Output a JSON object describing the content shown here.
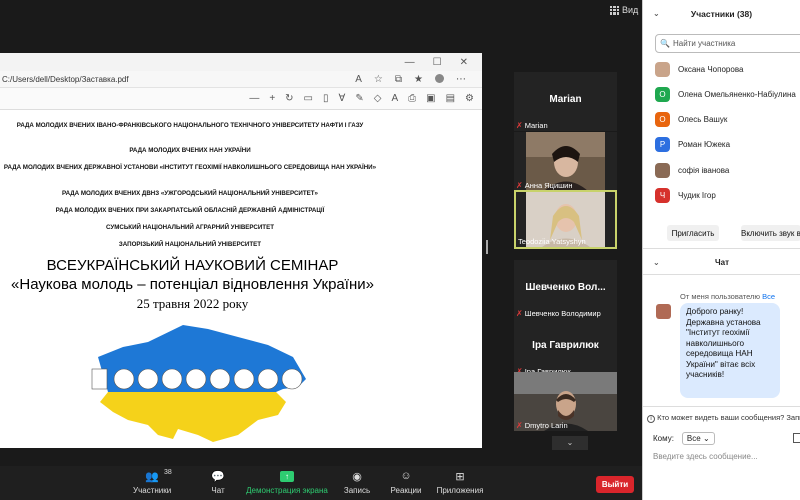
{
  "top": {
    "view_label": "Вид"
  },
  "pdf": {
    "url": "C:/Users/dell/Desktop/Заставка.pdf",
    "orgs": [
      "РАДА МОЛОДИХ ВЧЕНИХ ІВАНО-ФРАНКІВСЬКОГО НАЦІОНАЛЬНОГО ТЕХНІЧНОГО УНІВЕРСИТЕТУ НАФТИ І ГАЗУ",
      "РАДА МОЛОДИХ ВЧЕНИХ НАН УКРАЇНИ",
      "РАДА МОЛОДИХ ВЧЕНИХ ДЕРЖАВНОЇ УСТАНОВИ «ІНСТИТУТ ГЕОХІМІЇ НАВКОЛИШНЬОГО СЕРЕДОВИЩА НАН УКРАЇНИ»",
      "РАДА МОЛОДИХ ВЧЕНИХ ДВНЗ «УЖГОРОДСЬКИЙ НАЦІОНАЛЬНИЙ УНІВЕРСИТЕТ»",
      "РАДА МОЛОДИХ ВЧЕНИХ ПРИ ЗАКАРПАТСЬКІЙ ОБЛАСНІЙ ДЕРЖАВНІЙ АДМІНІСТРАЦІЇ",
      "СУМСЬКИЙ НАЦІОНАЛЬНИЙ АГРАРНИЙ УНІВЕРСИТЕТ",
      "ЗАПОРІЗЬКИЙ НАЦІОНАЛЬНИЙ УНІВЕРСИТЕТ"
    ],
    "title_line1": "ВСЕУКРАЇНСЬКИЙ НАУКОВИЙ СЕМІНАР",
    "title_line2": "«Наукова молодь – потенціал відновлення України»",
    "date": "25 травня 2022 року"
  },
  "tiles": [
    {
      "big_name": "Marian",
      "caption": "Marian"
    },
    {
      "caption": "Анна Яцишин"
    },
    {
      "caption": "Teodoziia Yatsyshyn"
    },
    {
      "big_name": "Шевченко Вол...",
      "caption": "Шевченко Володимир"
    },
    {
      "big_name": "Іра Гаврилюк",
      "caption": "Іра Гаврилюк"
    },
    {
      "caption": "Dmytro Larin"
    }
  ],
  "toolbar": {
    "participants_label": "Участники",
    "participants_count": "38",
    "chat_label": "Чат",
    "share_label": "Демонстрация экрана",
    "record_label": "Запись",
    "reactions_label": "Реакции",
    "apps_label": "Приложения",
    "leave_label": "Выйти"
  },
  "participants_panel": {
    "title": "Участники (38)",
    "search_placeholder": "Найти участника",
    "list": [
      {
        "name": "Оксана Чопорова",
        "initial": "",
        "color": "#c9a48a"
      },
      {
        "name": "Олена Омельяненко-Набіулина",
        "initial": "О",
        "color": "#1fa84f"
      },
      {
        "name": "Олесь Вашук",
        "initial": "О",
        "color": "#e8650e"
      },
      {
        "name": "Роман Южека",
        "initial": "Р",
        "color": "#2d6fe0"
      },
      {
        "name": "софія іванова",
        "initial": "",
        "color": "#8a6a55"
      },
      {
        "name": "Чудик Ігор",
        "initial": "Ч",
        "color": "#d6312c"
      }
    ],
    "invite_label": "Пригласить",
    "mute_all_label": "Включить звук всем"
  },
  "chat_panel": {
    "title": "Чат",
    "from_prefix": "От меня пользователю",
    "from_target": "Все",
    "message": "Доброго ранку! Державна установа \"Інститут геохімії навколишнього середовища НАН України\" вітає всіх учасників!",
    "who_sees": "Кто может видеть ваши сообщения? Запись",
    "to_label": "Кому:",
    "to_value": "Все",
    "input_placeholder": "Введите здесь сообщение..."
  }
}
